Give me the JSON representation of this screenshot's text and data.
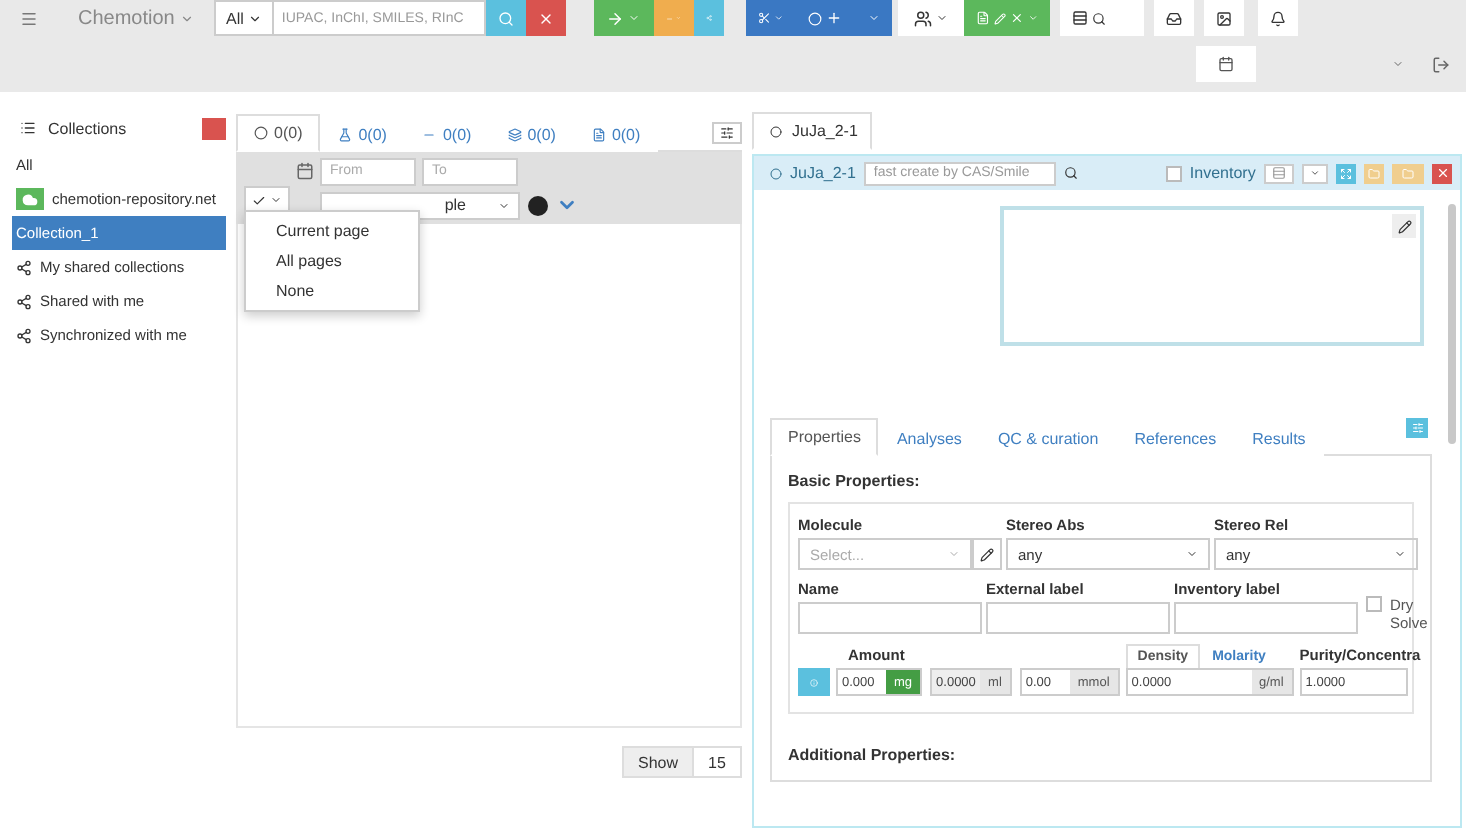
{
  "navbar": {
    "brand": "Chemotion",
    "search": {
      "scope": "All",
      "placeholder": "IUPAC, InChI, SMILES, RInC"
    }
  },
  "sidebar": {
    "title": "Collections",
    "items": [
      {
        "label": "All",
        "kind": "plain",
        "selected": false
      },
      {
        "label": "chemotion-repository.net",
        "kind": "repo",
        "selected": false
      },
      {
        "label": "Collection_1",
        "kind": "plain",
        "selected": true
      },
      {
        "label": "My shared collections",
        "kind": "shared",
        "selected": false
      },
      {
        "label": "Shared with me",
        "kind": "shared",
        "selected": false
      },
      {
        "label": "Synchronized with me",
        "kind": "shared",
        "selected": false
      }
    ]
  },
  "list_panel": {
    "tabs": [
      {
        "kind": "sample",
        "count": "0(0)",
        "selected": true
      },
      {
        "kind": "reaction",
        "count": "0(0)",
        "selected": false
      },
      {
        "kind": "wellplate",
        "count": "0(0)",
        "selected": false
      },
      {
        "kind": "screen",
        "count": "0(0)",
        "selected": false
      },
      {
        "kind": "research_plan",
        "count": "0(0)",
        "selected": false
      }
    ],
    "filter": {
      "from_placeholder": "From",
      "to_placeholder": "To",
      "group_visible": "ple"
    },
    "select_menu": [
      "Current page",
      "All pages",
      "None"
    ],
    "pagination": {
      "label": "Show",
      "value": "15"
    }
  },
  "detail": {
    "tab": {
      "label": "JuJa_2-1",
      "selected": true
    },
    "header": {
      "title": "JuJa_2-1",
      "fast_create_placeholder": "fast create by CAS/Smile",
      "inventory": {
        "label": "Inventory",
        "checked": false
      }
    },
    "property_tabs": [
      {
        "label": "Properties",
        "selected": true
      },
      {
        "label": "Analyses",
        "selected": false
      },
      {
        "label": "QC & curation",
        "selected": false
      },
      {
        "label": "References",
        "selected": false
      },
      {
        "label": "Results",
        "selected": false
      }
    ],
    "basic": {
      "title": "Basic Properties:",
      "selects": [
        {
          "label": "Molecule",
          "placeholder": "Select..."
        },
        {
          "label": "Stereo Abs",
          "value": "any"
        },
        {
          "label": "Stereo Rel",
          "value": "any"
        }
      ],
      "inputs": [
        {
          "label": "Name"
        },
        {
          "label": "External label"
        },
        {
          "label": "Inventory label"
        }
      ],
      "dry_solvent": {
        "label": "Dry Solve",
        "checked": false
      },
      "amount": {
        "label": "Amount",
        "density_tabs": [
          {
            "label": "Density",
            "selected": true
          },
          {
            "label": "Molarity",
            "selected": false
          }
        ],
        "purity_label": "Purity/Concentra",
        "fields": [
          {
            "value": "0.000",
            "unit": "mg",
            "active": true,
            "disabled": false
          },
          {
            "value": "0.0000",
            "unit": "ml",
            "active": false,
            "disabled": true
          },
          {
            "value": "0.00",
            "unit": "mmol",
            "active": false,
            "disabled": false
          }
        ],
        "density": {
          "value": "0.0000",
          "unit": "g/ml"
        },
        "purity": {
          "value": "1.0000"
        }
      }
    },
    "additional_title": "Additional Properties:"
  }
}
